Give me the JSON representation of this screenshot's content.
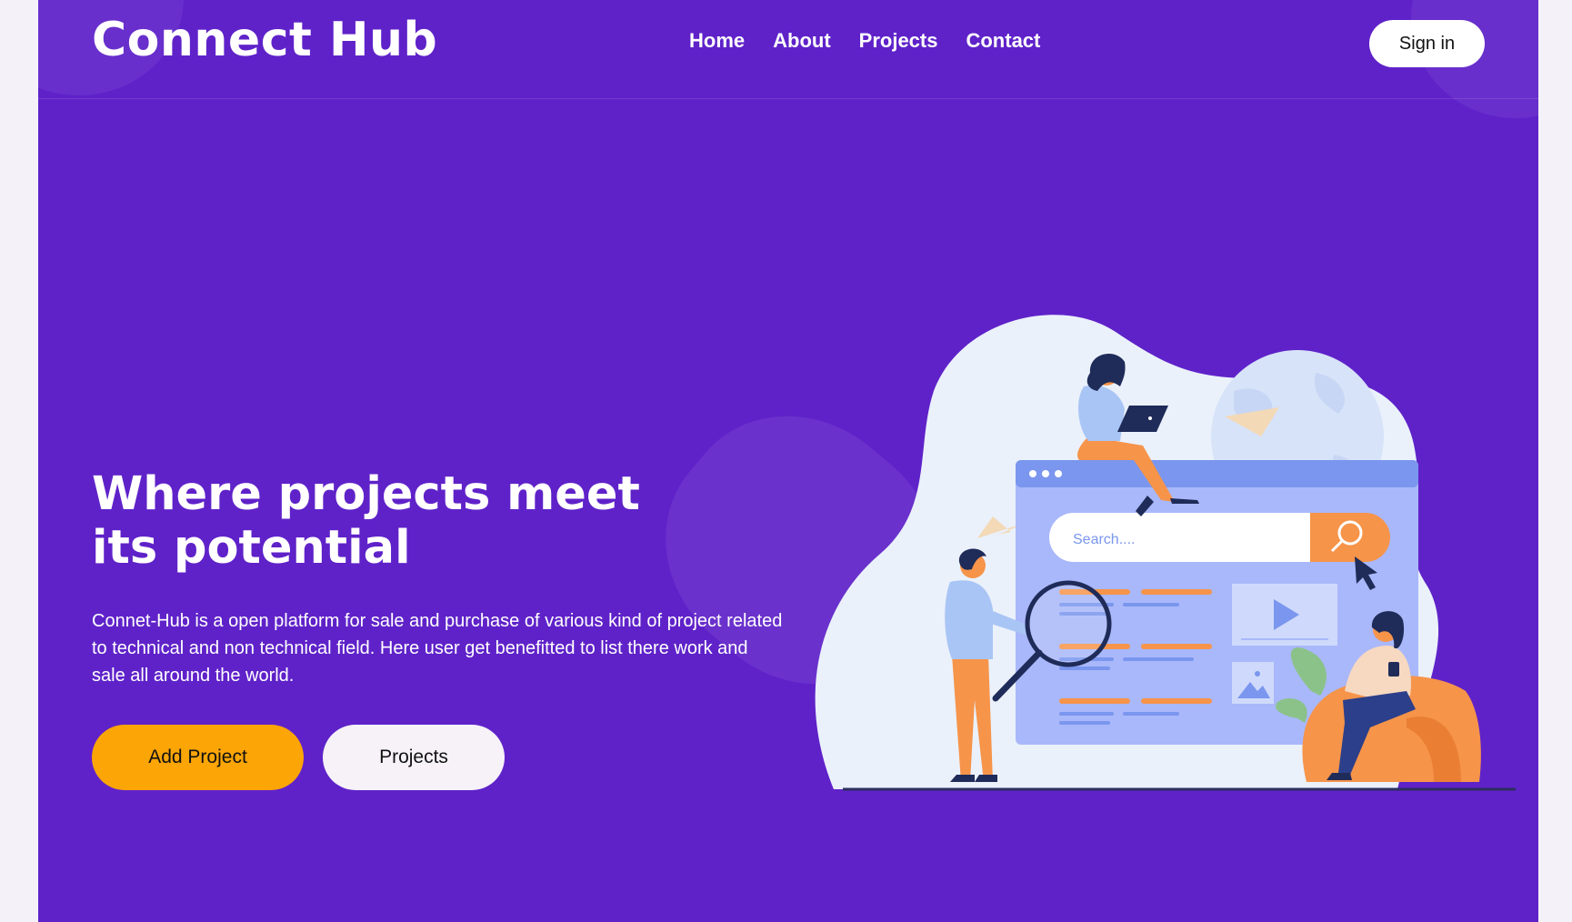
{
  "header": {
    "logo": "Connect Hub",
    "nav": [
      "Home",
      "About",
      "Projects",
      "Contact"
    ],
    "signin": "Sign in"
  },
  "hero": {
    "title": "Where projects meet its potential",
    "description": "Connet-Hub is a open platform for sale and purchase of various kind of project related to technical and non technical field. Here user get benefitted to list there work and sale all around the world.",
    "primary_button": "Add Project",
    "secondary_button": "Projects"
  },
  "illustration": {
    "search_placeholder": "Search...."
  },
  "colors": {
    "background": "#5f22c9",
    "accent": "#fba507",
    "illustration_orange": "#f6944a",
    "illustration_blue": "#a9b8fa"
  }
}
